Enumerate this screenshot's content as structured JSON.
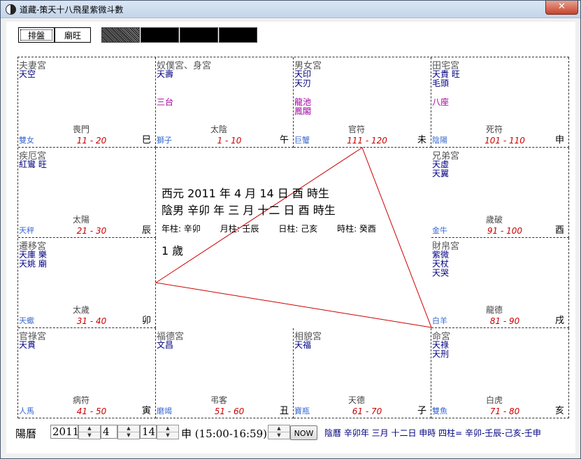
{
  "window": {
    "title": "道藏-策天十八飛星紫微斗數",
    "close_glyph": "✕"
  },
  "toolbar": {
    "tabs": [
      {
        "label": "排盤"
      },
      {
        "label": "廟旺"
      }
    ]
  },
  "colors": {
    "star_blue": "#000080",
    "minor_purple": "#a000a0",
    "age_red": "#cc0000",
    "sign_blue": "#3a6ad0",
    "line_red": "#cc0000"
  },
  "palaces": [
    {
      "name": "夫妻宮",
      "stars": [
        "天空"
      ],
      "minor": [],
      "god": "喪門",
      "sign": "雙女",
      "age": "11 - 20",
      "branch": "巳"
    },
    {
      "name": "奴僕宮、身宮",
      "stars": [
        "天壽"
      ],
      "minor": [
        "三台"
      ],
      "god": "太陰",
      "sign": "獅子",
      "age": "1 - 10",
      "branch": "午"
    },
    {
      "name": "男女宮",
      "stars": [
        "天印",
        "天刃"
      ],
      "minor": [
        "龍池",
        "鳳閣"
      ],
      "god": "官符",
      "sign": "巨蟹",
      "age": "111 - 120",
      "branch": "未"
    },
    {
      "name": "田宅宮",
      "stars": [
        "天貴 旺",
        "毛頭"
      ],
      "minor": [
        "八座"
      ],
      "god": "死符",
      "sign": "陰陽",
      "age": "101 - 110",
      "branch": "申"
    },
    {
      "name": "疾厄宮",
      "stars": [
        "紅鸞 旺"
      ],
      "minor": [],
      "god": "太陽",
      "sign": "天秤",
      "age": "21 - 30",
      "branch": "辰"
    },
    {
      "name": "兄弟宮",
      "stars": [
        "天虛",
        "天翼"
      ],
      "minor": [],
      "god": "歲破",
      "sign": "金牛",
      "age": "91 - 100",
      "branch": "酉"
    },
    {
      "name": "遷移宮",
      "stars": [
        "天庫 樂",
        "天姚 廟"
      ],
      "minor": [],
      "god": "太歲",
      "sign": "天蠍",
      "age": "31 - 40",
      "branch": "卯"
    },
    {
      "name": "財帛宮",
      "stars": [
        "紫微",
        "天杖",
        "天哭"
      ],
      "minor": [],
      "god": "龍德",
      "sign": "白羊",
      "age": "81 - 90",
      "branch": "戌"
    },
    {
      "name": "官祿宮",
      "stars": [
        "天貫"
      ],
      "minor": [],
      "god": "病符",
      "sign": "人馬",
      "age": "41 - 50",
      "branch": "寅"
    },
    {
      "name": "福德宮",
      "stars": [
        "文昌"
      ],
      "minor": [],
      "god": "弔客",
      "sign": "磨竭",
      "age": "51 - 60",
      "branch": "丑"
    },
    {
      "name": "相貌宮",
      "stars": [
        "天福"
      ],
      "minor": [],
      "god": "天德",
      "sign": "寶瓶",
      "age": "61 - 70",
      "branch": "子"
    },
    {
      "name": "命宮",
      "stars": [
        "天祿",
        "天刑"
      ],
      "minor": [],
      "god": "白虎",
      "sign": "雙魚",
      "age": "71 - 80",
      "branch": "亥"
    }
  ],
  "center": {
    "line1": "西元  2011 年 4 月 14 日 酉 時生",
    "line2": "陰男  辛卯 年 三 月 十二 日 酉 時生",
    "pillars": [
      {
        "label": "年柱:  辛卯"
      },
      {
        "label": "月柱:  壬辰"
      },
      {
        "label": "日柱:  己亥"
      },
      {
        "label": "時柱:  癸酉"
      }
    ],
    "age": "1 歲"
  },
  "bottom": {
    "calendar_label": "陽曆",
    "year": "2011",
    "month": "4",
    "day": "14",
    "hour_label": "申  (15:00-16:59)",
    "now_label": "NOW",
    "info": "陰曆  辛卯年 三月 十二日 申時   四柱= 辛卯-壬辰-己亥-壬申"
  }
}
